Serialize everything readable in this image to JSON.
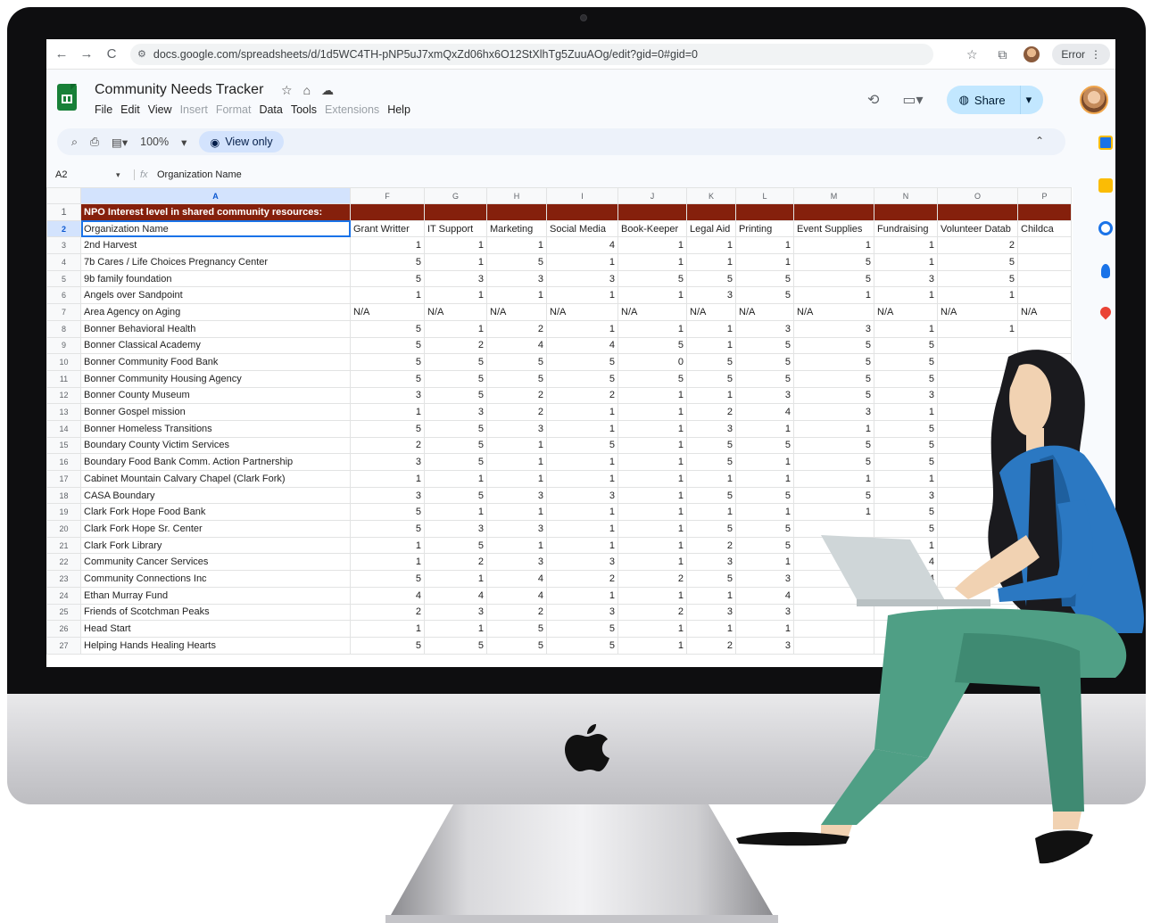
{
  "browser": {
    "url": "docs.google.com/spreadsheets/d/1d5WC4TH-pNP5uJ7xmQxZd06hx6O12StXlhTg5ZuuAOg/edit?gid=0#gid=0",
    "error_label": "Error",
    "nav": {
      "back": "←",
      "forward": "→",
      "reload": "C"
    }
  },
  "doc": {
    "title": "Community Needs Tracker",
    "menu": [
      "File",
      "Edit",
      "View",
      "Insert",
      "Format",
      "Data",
      "Tools",
      "Extensions",
      "Help"
    ],
    "menu_disabled": [
      "Insert",
      "Format",
      "Extensions"
    ],
    "share_label": "Share"
  },
  "toolbar": {
    "zoom": "100%",
    "view_only_label": "View only"
  },
  "formula": {
    "cell_ref": "A2",
    "content": "Organization Name"
  },
  "sheet": {
    "columns": [
      "A",
      "F",
      "G",
      "H",
      "I",
      "J",
      "K",
      "L",
      "M",
      "N",
      "O",
      "P"
    ],
    "banner": "NPO Interest level in shared community resources:",
    "headers": [
      "Organization Name",
      "Grant Writter",
      "IT Support",
      "Marketing",
      "Social Media",
      "Book-Keeper",
      "Legal Aid",
      "Printing",
      "Event Supplies",
      "Fundraising",
      "Volunteer Datab",
      "Childca"
    ],
    "rows": [
      {
        "n": "3",
        "name": "2nd Harvest",
        "v": [
          "1",
          "1",
          "1",
          "4",
          "1",
          "1",
          "1",
          "1",
          "1",
          "2",
          ""
        ]
      },
      {
        "n": "4",
        "name": "7b Cares / Life Choices Pregnancy Center",
        "v": [
          "5",
          "1",
          "5",
          "1",
          "1",
          "1",
          "1",
          "5",
          "1",
          "5",
          ""
        ]
      },
      {
        "n": "5",
        "name": "9b family foundation",
        "v": [
          "5",
          "3",
          "3",
          "3",
          "5",
          "5",
          "5",
          "5",
          "3",
          "5",
          ""
        ]
      },
      {
        "n": "6",
        "name": "Angels over Sandpoint",
        "v": [
          "1",
          "1",
          "1",
          "1",
          "1",
          "3",
          "5",
          "1",
          "1",
          "1",
          ""
        ]
      },
      {
        "n": "7",
        "name": "Area Agency on Aging",
        "v": [
          "N/A",
          "N/A",
          "N/A",
          "N/A",
          "N/A",
          "N/A",
          "N/A",
          "N/A",
          "N/A",
          "N/A",
          "N/A"
        ]
      },
      {
        "n": "8",
        "name": "Bonner Behavioral Health",
        "v": [
          "5",
          "1",
          "2",
          "1",
          "1",
          "1",
          "3",
          "3",
          "1",
          "1",
          ""
        ]
      },
      {
        "n": "9",
        "name": "Bonner Classical Academy",
        "v": [
          "5",
          "2",
          "4",
          "4",
          "5",
          "1",
          "5",
          "5",
          "5",
          "",
          ""
        ]
      },
      {
        "n": "10",
        "name": "Bonner Community Food Bank",
        "v": [
          "5",
          "5",
          "5",
          "5",
          "0",
          "5",
          "5",
          "5",
          "5",
          "",
          ""
        ]
      },
      {
        "n": "11",
        "name": "Bonner Community Housing Agency",
        "v": [
          "5",
          "5",
          "5",
          "5",
          "5",
          "5",
          "5",
          "5",
          "5",
          "",
          ""
        ]
      },
      {
        "n": "12",
        "name": "Bonner County Museum",
        "v": [
          "3",
          "5",
          "2",
          "2",
          "1",
          "1",
          "3",
          "5",
          "3",
          "",
          ""
        ]
      },
      {
        "n": "13",
        "name": "Bonner Gospel mission",
        "v": [
          "1",
          "3",
          "2",
          "1",
          "1",
          "2",
          "4",
          "3",
          "1",
          "",
          ""
        ]
      },
      {
        "n": "14",
        "name": "Bonner Homeless Transitions",
        "v": [
          "5",
          "5",
          "3",
          "1",
          "1",
          "3",
          "1",
          "1",
          "5",
          "",
          ""
        ]
      },
      {
        "n": "15",
        "name": "Boundary County Victim Services",
        "v": [
          "2",
          "5",
          "1",
          "5",
          "1",
          "5",
          "5",
          "5",
          "5",
          "",
          ""
        ]
      },
      {
        "n": "16",
        "name": "Boundary Food Bank Comm. Action Partnership",
        "v": [
          "3",
          "5",
          "1",
          "1",
          "1",
          "5",
          "1",
          "5",
          "5",
          "",
          ""
        ]
      },
      {
        "n": "17",
        "name": "Cabinet Mountain Calvary Chapel (Clark Fork)",
        "v": [
          "1",
          "1",
          "1",
          "1",
          "1",
          "1",
          "1",
          "1",
          "1",
          "",
          ""
        ]
      },
      {
        "n": "18",
        "name": "CASA Boundary",
        "v": [
          "3",
          "5",
          "3",
          "3",
          "1",
          "5",
          "5",
          "5",
          "3",
          "",
          ""
        ]
      },
      {
        "n": "19",
        "name": "Clark Fork Hope Food Bank",
        "v": [
          "5",
          "1",
          "1",
          "1",
          "1",
          "1",
          "1",
          "1",
          "5",
          "",
          ""
        ]
      },
      {
        "n": "20",
        "name": "Clark Fork Hope Sr. Center",
        "v": [
          "5",
          "3",
          "3",
          "1",
          "1",
          "5",
          "5",
          "",
          "5",
          "",
          ""
        ]
      },
      {
        "n": "21",
        "name": "Clark Fork Library",
        "v": [
          "1",
          "5",
          "1",
          "1",
          "1",
          "2",
          "5",
          "",
          "1",
          "",
          ""
        ]
      },
      {
        "n": "22",
        "name": "Community Cancer Services",
        "v": [
          "1",
          "2",
          "3",
          "3",
          "1",
          "3",
          "1",
          "",
          "4",
          "",
          ""
        ]
      },
      {
        "n": "23",
        "name": "Community Connections Inc",
        "v": [
          "5",
          "1",
          "4",
          "2",
          "2",
          "5",
          "3",
          "",
          "4",
          "",
          ""
        ]
      },
      {
        "n": "24",
        "name": "Ethan Murray Fund",
        "v": [
          "4",
          "4",
          "4",
          "1",
          "1",
          "1",
          "4",
          "",
          "",
          "",
          ""
        ]
      },
      {
        "n": "25",
        "name": "Friends of Scotchman Peaks",
        "v": [
          "2",
          "3",
          "2",
          "3",
          "2",
          "3",
          "3",
          "",
          "",
          "",
          ""
        ]
      },
      {
        "n": "26",
        "name": "Head Start",
        "v": [
          "1",
          "1",
          "5",
          "5",
          "1",
          "1",
          "1",
          "",
          "",
          "",
          ""
        ]
      },
      {
        "n": "27",
        "name": "Helping Hands Healing Hearts",
        "v": [
          "5",
          "5",
          "5",
          "5",
          "1",
          "2",
          "3",
          "",
          "",
          "",
          ""
        ]
      }
    ]
  },
  "colors": {
    "banner": "#85200c",
    "share": "#c2e7ff",
    "selection": "#1a73e8",
    "jacket": "#2b78c2",
    "pants": "#4f9f85"
  }
}
